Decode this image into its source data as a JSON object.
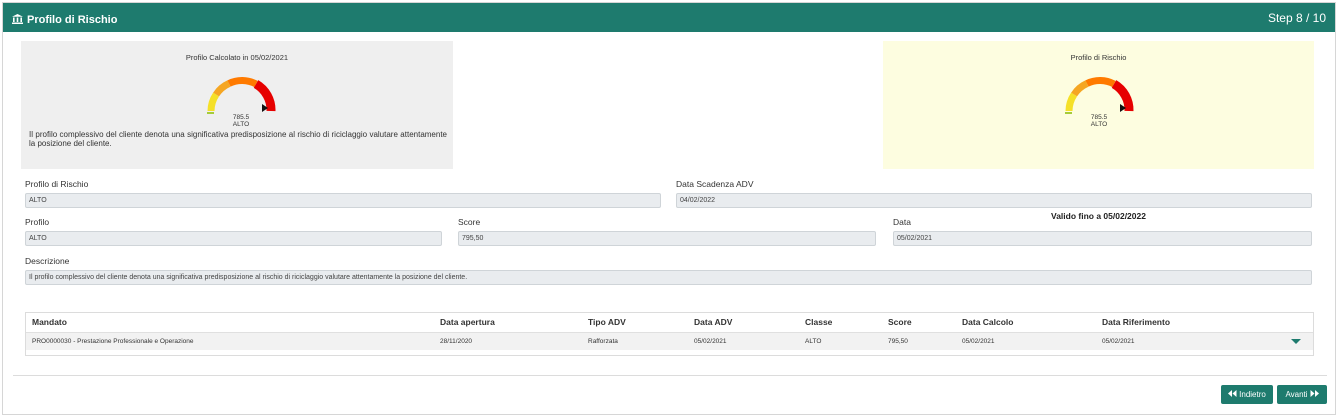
{
  "header": {
    "title": "Profilo di Rischio",
    "step": "Step 8 / 10",
    "icon": "bank-icon"
  },
  "calc_panel": {
    "title": "Profilo Calcolato in 05/02/2021",
    "score": "785.5",
    "level": "ALTO",
    "description": "Il profilo complessivo del cliente denota una significativa predisposizione al rischio di riciclaggio valutare attentamente la posizione del cliente."
  },
  "risk_panel": {
    "title": "Profilo di Rischio",
    "score": "785.5",
    "level": "ALTO"
  },
  "gauge": {
    "level_fraction": 0.93,
    "colors": [
      "#f5e028",
      "#a6cc3a",
      "#f5a623",
      "#ff7a00",
      "#e60000"
    ]
  },
  "form": {
    "profilo_rischio": {
      "label": "Profilo di Rischio",
      "value": "ALTO"
    },
    "data_scadenza": {
      "label": "Data Scadenza ADV",
      "value": "04/02/2022"
    },
    "profilo": {
      "label": "Profilo",
      "value": "ALTO"
    },
    "score": {
      "label": "Score",
      "value": "795,50"
    },
    "data": {
      "label": "Data",
      "value": "05/02/2021"
    },
    "valido": "Valido fino a 05/02/2022",
    "descrizione": {
      "label": "Descrizione",
      "value": "Il profilo complessivo del cliente denota una significativa predisposizione al rischio di riciclaggio valutare attentamente la posizione del cliente."
    }
  },
  "table": {
    "headers": [
      "Mandato",
      "Data apertura",
      "Tipo ADV",
      "Data ADV",
      "Classe",
      "Score",
      "Data Calcolo",
      "Data Riferimento"
    ],
    "rows": [
      [
        "PRO0000030 - Prestazione Professionale e Operazione",
        "28/11/2020",
        "Rafforzata",
        "05/02/2021",
        "ALTO",
        "795,50",
        "05/02/2021",
        "05/02/2021"
      ]
    ]
  },
  "buttons": {
    "back": "Indietro",
    "next": "Avanti"
  },
  "colors": {
    "accent": "#1e7b6e",
    "calc_panel_bg": "#efefef",
    "risk_panel_bg": "#fdfde0"
  }
}
